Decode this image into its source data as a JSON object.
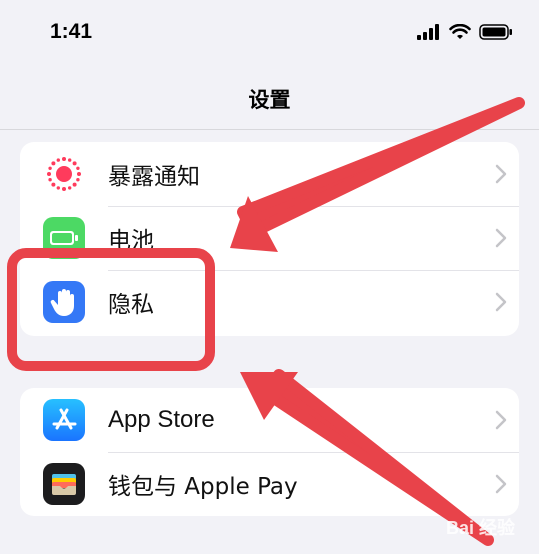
{
  "status_bar": {
    "time": "1:41"
  },
  "nav": {
    "title": "设置"
  },
  "groups": [
    {
      "rows": [
        {
          "label": "暴露通知",
          "icon": "exposure-notification-icon",
          "icon_color": "#ffffff"
        },
        {
          "label": "电池",
          "icon": "battery-icon",
          "icon_color": "#4cd964"
        },
        {
          "label": "隐私",
          "icon": "privacy-hand-icon",
          "icon_color": "#3478f6"
        }
      ]
    },
    {
      "rows": [
        {
          "label": "App Store",
          "icon": "app-store-icon",
          "icon_color": "#1a8cff"
        },
        {
          "label": "钱包与 Apple Pay",
          "icon": "wallet-icon",
          "icon_color": "#1c1c1e"
        }
      ]
    }
  ],
  "annotation": {
    "highlight_color": "#e8434a"
  },
  "watermark": "Bai 经验"
}
